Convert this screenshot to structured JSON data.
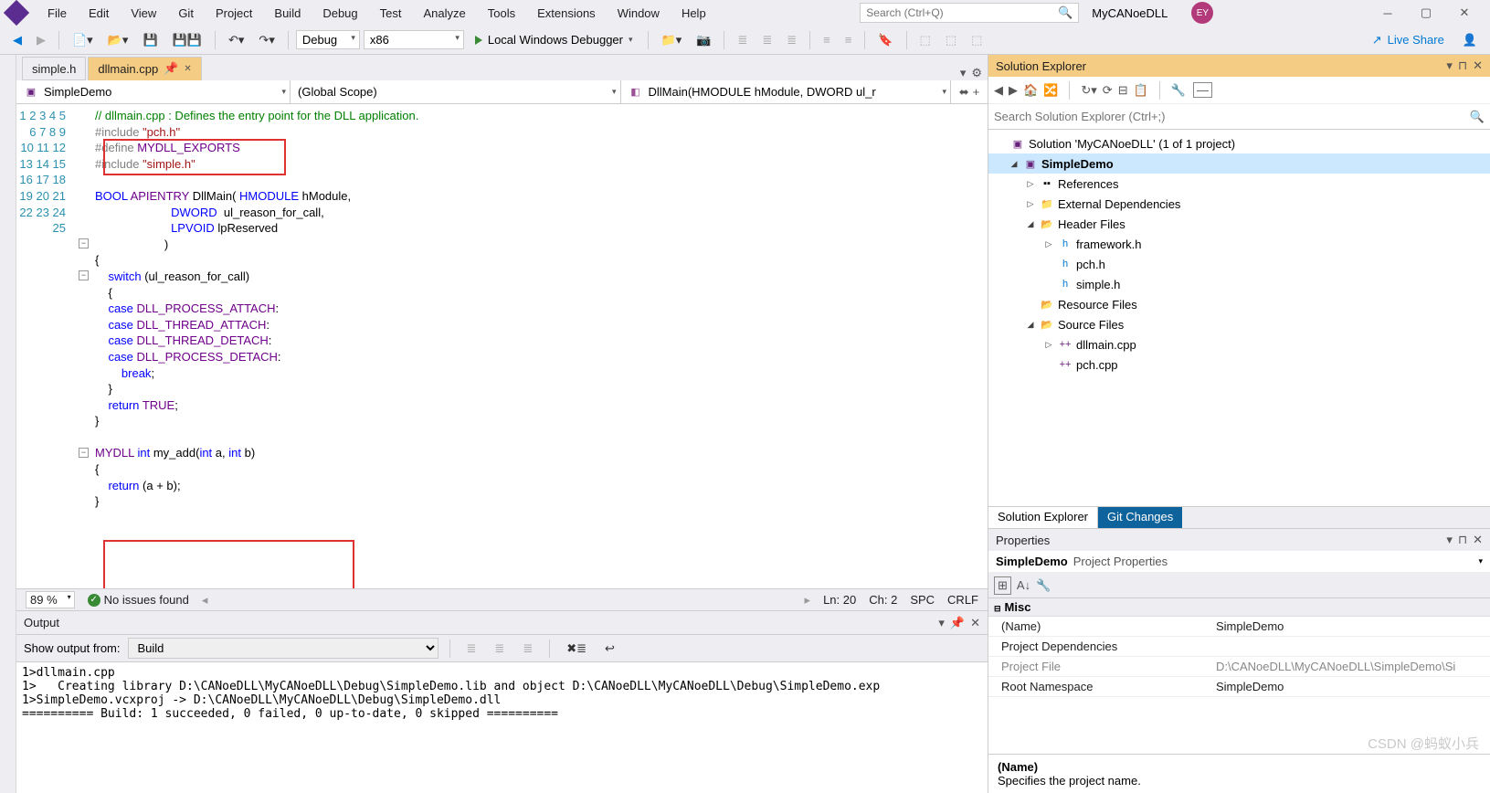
{
  "menu": {
    "items": [
      "File",
      "Edit",
      "View",
      "Git",
      "Project",
      "Build",
      "Debug",
      "Test",
      "Analyze",
      "Tools",
      "Extensions",
      "Window",
      "Help"
    ]
  },
  "search": {
    "placeholder": "Search (Ctrl+Q)"
  },
  "startup": {
    "name": "MyCANoeDLL"
  },
  "user": {
    "initials": "EY"
  },
  "toolbar": {
    "config": "Debug",
    "platform": "x86",
    "start": "Local Windows Debugger",
    "liveshare": "Live Share"
  },
  "tabs": {
    "t0": "simple.h",
    "t1": "dllmain.cpp"
  },
  "nav": {
    "proj": "SimpleDemo",
    "scope": "(Global Scope)",
    "func": "DllMain(HMODULE hModule, DWORD ul_r"
  },
  "code": {
    "lines": [
      "1",
      "2",
      "3",
      "4",
      "5",
      "6",
      "7",
      "8",
      "9",
      "10",
      "11",
      "12",
      "13",
      "14",
      "15",
      "16",
      "17",
      "18",
      "19",
      "20",
      "21",
      "22",
      "23",
      "24",
      "25"
    ]
  },
  "status": {
    "zoom": "89 %",
    "issues": "No issues found",
    "ln": "Ln: 20",
    "ch": "Ch: 2",
    "spc": "SPC",
    "crlf": "CRLF"
  },
  "output": {
    "title": "Output",
    "label": "Show output from:",
    "source": "Build",
    "text": "1>dllmain.cpp\n1>   Creating library D:\\CANoeDLL\\MyCANoeDLL\\Debug\\SimpleDemo.lib and object D:\\CANoeDLL\\MyCANoeDLL\\Debug\\SimpleDemo.exp\n1>SimpleDemo.vcxproj -> D:\\CANoeDLL\\MyCANoeDLL\\Debug\\SimpleDemo.dll\n========== Build: 1 succeeded, 0 failed, 0 up-to-date, 0 skipped =========="
  },
  "se": {
    "title": "Solution Explorer",
    "search": "Search Solution Explorer (Ctrl+;)",
    "solution": "Solution 'MyCANoeDLL' (1 of 1 project)",
    "proj": "SimpleDemo",
    "refs": "References",
    "ext": "External Dependencies",
    "hdr": "Header Files",
    "h0": "framework.h",
    "h1": "pch.h",
    "h2": "simple.h",
    "res": "Resource Files",
    "src": "Source Files",
    "c0": "dllmain.cpp",
    "c1": "pch.cpp",
    "tab0": "Solution Explorer",
    "tab1": "Git Changes"
  },
  "props": {
    "title": "Properties",
    "obj": "SimpleDemo",
    "objtype": "Project Properties",
    "cat": "Misc",
    "r0n": "(Name)",
    "r0v": "SimpleDemo",
    "r1n": "Project Dependencies",
    "r1v": "",
    "r2n": "Project File",
    "r2v": "D:\\CANoeDLL\\MyCANoeDLL\\SimpleDemo\\Si",
    "r3n": "Root Namespace",
    "r3v": "SimpleDemo",
    "descN": "(Name)",
    "descT": "Specifies the project name."
  },
  "watermark": "CSDN @蚂蚁小兵"
}
